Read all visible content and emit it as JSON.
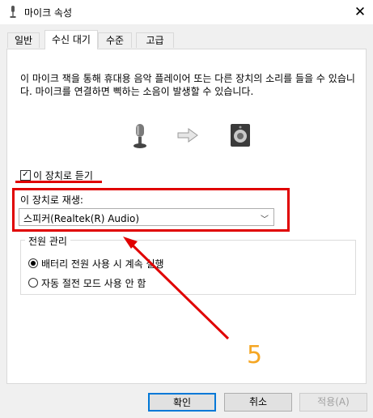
{
  "window": {
    "title": "마이크 속성",
    "close_glyph": "✕"
  },
  "tabs": [
    {
      "label": "일반"
    },
    {
      "label": "수신 대기"
    },
    {
      "label": "수준"
    },
    {
      "label": "고급"
    }
  ],
  "listen": {
    "description": "이 마이크 잭을 통해 휴대용 음악 플레이어 또는 다른 장치의 소리를 들을 수 있습니다. 마이크를 연결하면 삑하는 소음이 발생할 수 있습니다.",
    "checkbox_label": "이 장치로 듣기",
    "checkbox_checked": true,
    "playback_label": "이 장치로 재생:",
    "playback_device": "스피커(Realtek(R) Audio)"
  },
  "power": {
    "group_title": "전원 관리",
    "options": [
      {
        "label": "배터리 전원 사용 시 계속 실행",
        "selected": true
      },
      {
        "label": "자동 절전 모드 사용 안 함",
        "selected": false
      }
    ]
  },
  "annotation": {
    "step_number": "5",
    "color": "#e00000",
    "number_color": "#f5a623"
  },
  "footer": {
    "ok_label": "확인",
    "cancel_label": "취소",
    "apply_label": "적용(A)"
  },
  "icons": {
    "title": "microphone-icon",
    "source": "microphone-icon",
    "flow": "arrow-right-icon",
    "target": "speaker-icon",
    "dropdown": "chevron-down-icon"
  }
}
